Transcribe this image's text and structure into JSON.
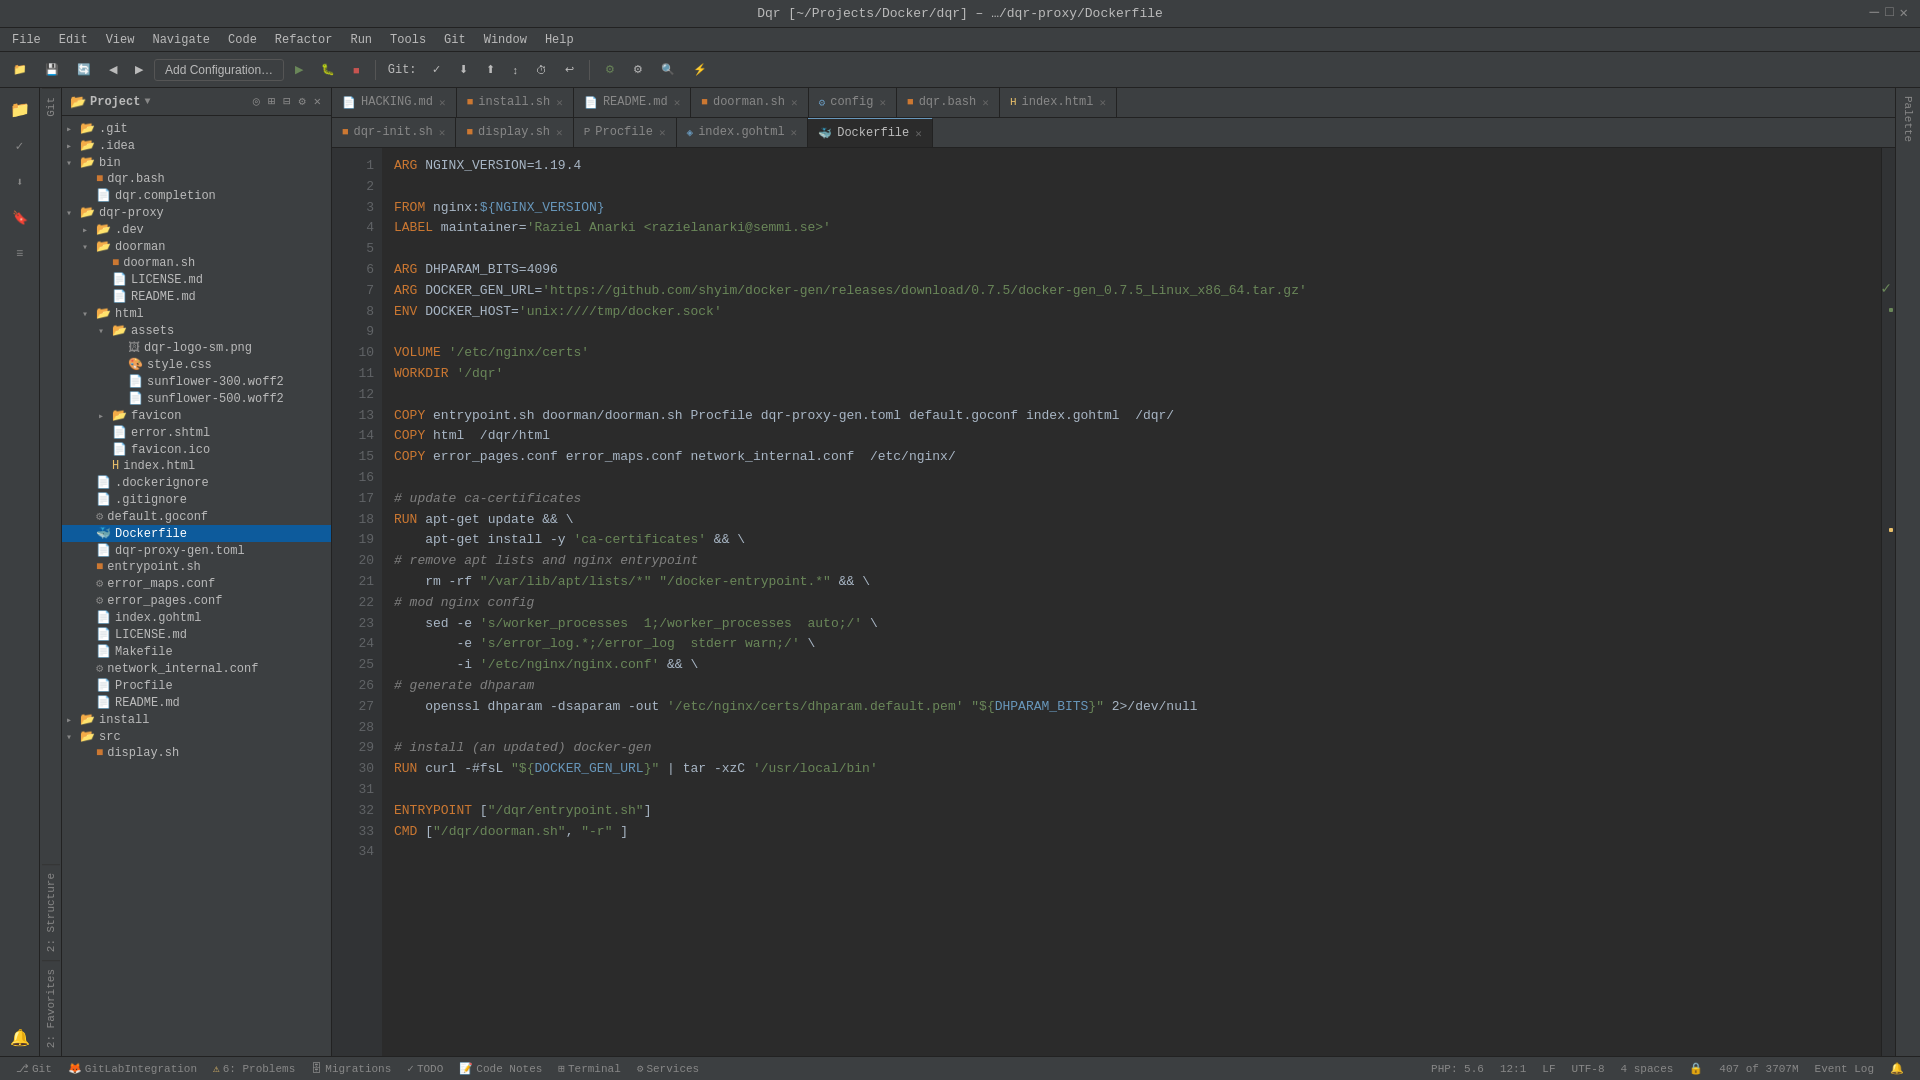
{
  "titleBar": {
    "text": "Dqr [~/Projects/Docker/dqr] – …/dqr-proxy/Dockerfile"
  },
  "menuBar": {
    "items": [
      "File",
      "Edit",
      "View",
      "Navigate",
      "Code",
      "Refactor",
      "Run",
      "Tools",
      "Git",
      "Window",
      "Help"
    ]
  },
  "toolbar": {
    "addConfig": "Add Configuration…",
    "gitLabel": "Git:"
  },
  "projectTree": {
    "title": "Project",
    "items": [
      {
        "label": ".git",
        "indent": 0,
        "type": "folder",
        "expanded": false
      },
      {
        "label": ".idea",
        "indent": 0,
        "type": "folder",
        "expanded": false
      },
      {
        "label": "bin",
        "indent": 0,
        "type": "folder",
        "expanded": true
      },
      {
        "label": "dqr.bash",
        "indent": 1,
        "type": "file-bash"
      },
      {
        "label": "dqr.completion",
        "indent": 1,
        "type": "file"
      },
      {
        "label": "dqr-proxy",
        "indent": 0,
        "type": "folder",
        "expanded": true
      },
      {
        "label": ".dev",
        "indent": 1,
        "type": "folder",
        "expanded": false
      },
      {
        "label": "doorman",
        "indent": 1,
        "type": "folder",
        "expanded": true
      },
      {
        "label": "doorman.sh",
        "indent": 2,
        "type": "file-bash"
      },
      {
        "label": "LICENSE.md",
        "indent": 2,
        "type": "file-md"
      },
      {
        "label": "README.md",
        "indent": 2,
        "type": "file-md"
      },
      {
        "label": "html",
        "indent": 1,
        "type": "folder",
        "expanded": true
      },
      {
        "label": "assets",
        "indent": 2,
        "type": "folder",
        "expanded": true
      },
      {
        "label": "dqr-logo-sm.png",
        "indent": 3,
        "type": "file-img"
      },
      {
        "label": "style.css",
        "indent": 3,
        "type": "file-css"
      },
      {
        "label": "sunflower-300.woff2",
        "indent": 3,
        "type": "file"
      },
      {
        "label": "sunflower-500.woff2",
        "indent": 3,
        "type": "file"
      },
      {
        "label": "favicon",
        "indent": 2,
        "type": "folder",
        "expanded": false
      },
      {
        "label": "error.shtml",
        "indent": 2,
        "type": "file"
      },
      {
        "label": "favicon.ico",
        "indent": 2,
        "type": "file"
      },
      {
        "label": "index.html",
        "indent": 2,
        "type": "file-html"
      },
      {
        "label": ".dockerignore",
        "indent": 1,
        "type": "file"
      },
      {
        "label": ".gitignore",
        "indent": 1,
        "type": "file"
      },
      {
        "label": "default.goconf",
        "indent": 1,
        "type": "file-config"
      },
      {
        "label": "Dockerfile",
        "indent": 1,
        "type": "file-docker",
        "selected": true
      },
      {
        "label": "dqr-proxy-gen.toml",
        "indent": 1,
        "type": "file"
      },
      {
        "label": "entrypoint.sh",
        "indent": 1,
        "type": "file-bash"
      },
      {
        "label": "error_maps.conf",
        "indent": 1,
        "type": "file-config"
      },
      {
        "label": "error_pages.conf",
        "indent": 1,
        "type": "file-config"
      },
      {
        "label": "index.gohtml",
        "indent": 1,
        "type": "file"
      },
      {
        "label": "LICENSE.md",
        "indent": 1,
        "type": "file-md"
      },
      {
        "label": "Makefile",
        "indent": 1,
        "type": "file"
      },
      {
        "label": "network_internal.conf",
        "indent": 1,
        "type": "file-config"
      },
      {
        "label": "Procfile",
        "indent": 1,
        "type": "file"
      },
      {
        "label": "README.md",
        "indent": 1,
        "type": "file-md"
      },
      {
        "label": "install",
        "indent": 0,
        "type": "folder",
        "expanded": false
      },
      {
        "label": "src",
        "indent": 0,
        "type": "folder",
        "expanded": true
      },
      {
        "label": "display.sh",
        "indent": 1,
        "type": "file-bash"
      }
    ]
  },
  "tabs": {
    "row1": [
      {
        "label": "HACKING.md",
        "icon": "md",
        "active": false
      },
      {
        "label": "install.sh",
        "icon": "bash",
        "active": false
      },
      {
        "label": "README.md",
        "icon": "md",
        "active": false
      },
      {
        "label": "doorman.sh",
        "icon": "bash",
        "active": false
      },
      {
        "label": "config",
        "icon": "config",
        "active": false
      },
      {
        "label": "dqr.bash",
        "icon": "bash",
        "active": false
      },
      {
        "label": "index.html",
        "icon": "html",
        "active": false
      }
    ],
    "row2": [
      {
        "label": "dqr-init.sh",
        "icon": "bash",
        "active": false
      },
      {
        "label": "display.sh",
        "icon": "bash",
        "active": false
      },
      {
        "label": "Procfile",
        "icon": "proc",
        "active": false
      },
      {
        "label": "index.gohtml",
        "icon": "go",
        "active": false
      },
      {
        "label": "Dockerfile",
        "icon": "docker",
        "active": true
      }
    ]
  },
  "editor": {
    "lines": [
      {
        "n": 1,
        "code": "ARG NGINX_VERSION=1.19.4"
      },
      {
        "n": 2,
        "code": ""
      },
      {
        "n": 3,
        "code": "FROM nginx:${NGINX_VERSION}"
      },
      {
        "n": 4,
        "code": "LABEL maintainer='Raziel Anarki <razielanarki@semmi.se>'"
      },
      {
        "n": 5,
        "code": ""
      },
      {
        "n": 6,
        "code": "ARG DHPARAM_BITS=4096"
      },
      {
        "n": 7,
        "code": "ARG DOCKER_GEN_URL='https://github.com/shyim/docker-gen/releases/download/0.7.5/docker-gen_0.7.5_Linux_x86_64.tar.gz'"
      },
      {
        "n": 8,
        "code": "ENV DOCKER_HOST='unix:////tmp/docker.sock'"
      },
      {
        "n": 9,
        "code": ""
      },
      {
        "n": 10,
        "code": "VOLUME '/etc/nginx/certs'"
      },
      {
        "n": 11,
        "code": "WORKDIR '/dqr'"
      },
      {
        "n": 12,
        "code": ""
      },
      {
        "n": 13,
        "code": "COPY entrypoint.sh doorman/doorman.sh Procfile dqr-proxy-gen.toml default.goconf index.gohtml  /dqr/"
      },
      {
        "n": 14,
        "code": "COPY html  /dqr/html"
      },
      {
        "n": 15,
        "code": "COPY error_pages.conf error_maps.conf network_internal.conf  /etc/nginx/"
      },
      {
        "n": 16,
        "code": ""
      },
      {
        "n": 17,
        "code": "# update ca-certificates"
      },
      {
        "n": 18,
        "code": "RUN apt-get update && \\"
      },
      {
        "n": 19,
        "code": "    apt-get install -y 'ca-certificates' && \\"
      },
      {
        "n": 20,
        "code": "# remove apt lists and nginx entrypoint"
      },
      {
        "n": 21,
        "code": "    rm -rf \"/var/lib/apt/lists/*\" \"/docker-entrypoint.*\" && \\"
      },
      {
        "n": 22,
        "code": "# mod nginx config"
      },
      {
        "n": 23,
        "code": "    sed -e 's/worker_processes  1;/worker_processes  auto;/' \\"
      },
      {
        "n": 24,
        "code": "        -e 's/error_log.*;/error_log  stderr warn;/' \\"
      },
      {
        "n": 25,
        "code": "        -i '/etc/nginx/nginx.conf' && \\"
      },
      {
        "n": 26,
        "code": "# generate dhparam"
      },
      {
        "n": 27,
        "code": "    openssl dhparam -dsaparam -out '/etc/nginx/certs/dhparam.default.pem' \"${DHPARAM_BITS}\" 2>/dev/null"
      },
      {
        "n": 28,
        "code": ""
      },
      {
        "n": 29,
        "code": "# install (an updated) docker-gen"
      },
      {
        "n": 30,
        "code": "RUN curl -#fsL \"${DOCKER_GEN_URL}\" | tar -xzC '/usr/local/bin'"
      },
      {
        "n": 31,
        "code": ""
      },
      {
        "n": 32,
        "code": "ENTRYPOINT [\"/dqr/entrypoint.sh\"]"
      },
      {
        "n": 33,
        "code": "CMD [\"/dqr/doorman.sh\", \"-r\" ]"
      },
      {
        "n": 34,
        "code": ""
      }
    ]
  },
  "statusBar": {
    "git": "Git",
    "gitIntegration": "GitLabIntegration",
    "problems": "6: Problems",
    "migrations": "Migrations",
    "todo": "TODO",
    "codeNotes": "Code Notes",
    "terminal": "Terminal",
    "services": "Services",
    "php": "PHP: 5.6",
    "position": "12:1",
    "lineSep": "LF",
    "encoding": "UTF-8",
    "indent": "4 spaces",
    "lock": "🔒",
    "eventLog": "Event Log",
    "lineCount": "407 of 3707M"
  },
  "rightPanels": {
    "favorites": "2: Favorites",
    "structure": "2: Structure"
  }
}
